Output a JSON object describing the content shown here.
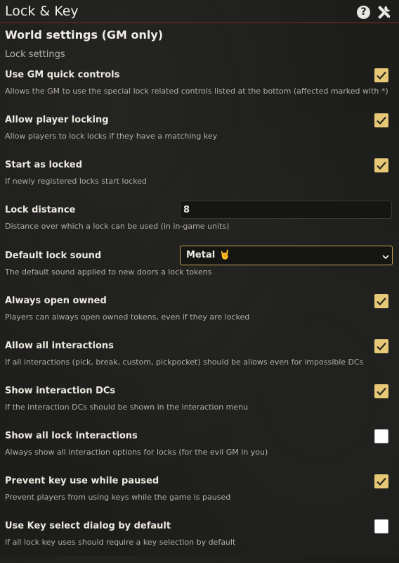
{
  "header": {
    "title": "Lock & Key",
    "help_icon": "question-icon",
    "tools_icon": "tools-icon"
  },
  "section_title": "World settings (GM only)",
  "subsection_title": "Lock settings",
  "colors": {
    "accent": "#e6c877",
    "header_rule": "#8a2a1f",
    "background": "#1d1d1b"
  },
  "settings": [
    {
      "label": "Use GM quick controls",
      "hint": "Allows the GM to use the special lock related controls listed at the bottom (affected marked with *)",
      "type": "checkbox",
      "checked": true
    },
    {
      "label": "Allow player locking",
      "hint": "Allow players to lock locks if they have a matching key",
      "type": "checkbox",
      "checked": true
    },
    {
      "label": "Start as locked",
      "hint": "If newly registered locks start locked",
      "type": "checkbox",
      "checked": true
    },
    {
      "label": "Lock distance",
      "hint": "Distance over which a lock can be used (in in-game units)",
      "type": "number",
      "value": "8"
    },
    {
      "label": "Default lock sound",
      "hint": "The default sound applied to new doors a lock tokens",
      "type": "select",
      "value": "Metal",
      "value_emoji": "🤘"
    },
    {
      "label": "Always open owned",
      "hint": "Players can always open owned tokens, even if they are locked",
      "type": "checkbox",
      "checked": true
    },
    {
      "label": "Allow all interactions",
      "hint": "If all interactions (pick, break, custom, pickpocket) should be allows even for impossible DCs",
      "type": "checkbox",
      "checked": true
    },
    {
      "label": "Show interaction DCs",
      "hint": "If the interaction DCs should be shown in the interaction menu",
      "type": "checkbox",
      "checked": true
    },
    {
      "label": "Show all lock interactions",
      "hint": "Always show all interaction options for locks (for the evil GM in you)",
      "type": "checkbox",
      "checked": false
    },
    {
      "label": "Prevent key use while paused",
      "hint": "Prevent players from using keys while the game is paused",
      "type": "checkbox",
      "checked": true
    },
    {
      "label": "Use Key select dialog by default",
      "hint": "If all lock key uses should require a key selection by default",
      "type": "checkbox",
      "checked": false
    }
  ]
}
